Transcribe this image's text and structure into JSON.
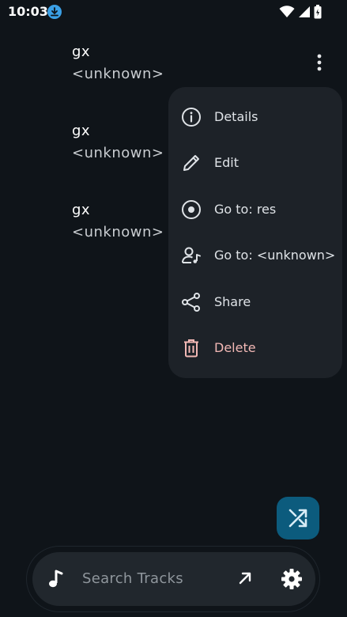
{
  "status_bar": {
    "time": "10:03"
  },
  "tracks": [
    {
      "title": "gx",
      "artist": "<unknown>"
    },
    {
      "title": "gx",
      "artist": "<unknown>"
    },
    {
      "title": "gx",
      "artist": "<unknown>"
    }
  ],
  "context_menu": {
    "items": [
      {
        "label": "Details",
        "icon": "info-icon"
      },
      {
        "label": "Edit",
        "icon": "pencil-icon"
      },
      {
        "label": "Go to: res",
        "icon": "album-icon"
      },
      {
        "label": "Go to: <unknown>",
        "icon": "artist-icon"
      },
      {
        "label": "Share",
        "icon": "share-icon"
      },
      {
        "label": "Delete",
        "icon": "trash-icon"
      }
    ]
  },
  "search": {
    "placeholder": "Search Tracks"
  },
  "colors": {
    "background": "#0f1419",
    "menu_background": "#1d2228",
    "fab": "#0c5b7d",
    "delete": "#f2b8b5"
  }
}
